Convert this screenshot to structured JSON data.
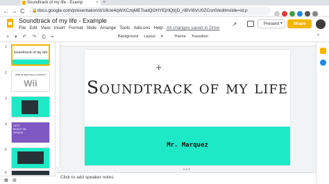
{
  "browser": {
    "tab_title": "Soundtrack of my life - Examp",
    "tab_close": "×",
    "new_tab": "+",
    "url": "docs.google.com/presentation/d/16Ue4qWXCzqMETsaIQOHYEjHQtrjD_rIBVI8VU0ZCon0/edit#slide=id.p",
    "lock": "🔒",
    "back": "←",
    "forward": "→",
    "reload": "C"
  },
  "app": {
    "doc_title": "Soundtrack of my life - Example",
    "title_icons": "☆ ▭",
    "menu": [
      "File",
      "Edit",
      "View",
      "Insert",
      "Format",
      "Slide",
      "Arrange",
      "Tools",
      "Add-ons",
      "Help"
    ],
    "saved_status": "All changes saved in Drive",
    "present_label": "Present",
    "present_caret": "▾",
    "share_label": "Share",
    "trend_icon": "↗"
  },
  "toolbar": {
    "left_icons": "+ ▾ ↶ ↷ ⎙ ⌖",
    "background_label": "Background",
    "layout_label": "Layout",
    "layout_caret": "▾",
    "theme_label": "Theme",
    "transition_label": "Transition",
    "collapse": "^"
  },
  "filmstrip": {
    "slide_numbers": [
      "1",
      "2",
      "3",
      "4",
      "5",
      "6"
    ],
    "thumb1_title": "Soundtrack of my life",
    "thumb2_caption": "What do these have in common?",
    "thumb2_wii": "Wii",
    "thumb4_text": "LET'S BEGIN THE LESSON"
  },
  "slide": {
    "title": "Soundtrack of my life",
    "subtitle": "Mr. Marquez"
  },
  "notes": {
    "placeholder": "Click to add speaker notes",
    "handle": "• • •"
  },
  "colors": {
    "accent": "#f4b400",
    "band": "#1de9c6",
    "dark_slide": "#263238",
    "purple_slide": "#7e57c2"
  }
}
